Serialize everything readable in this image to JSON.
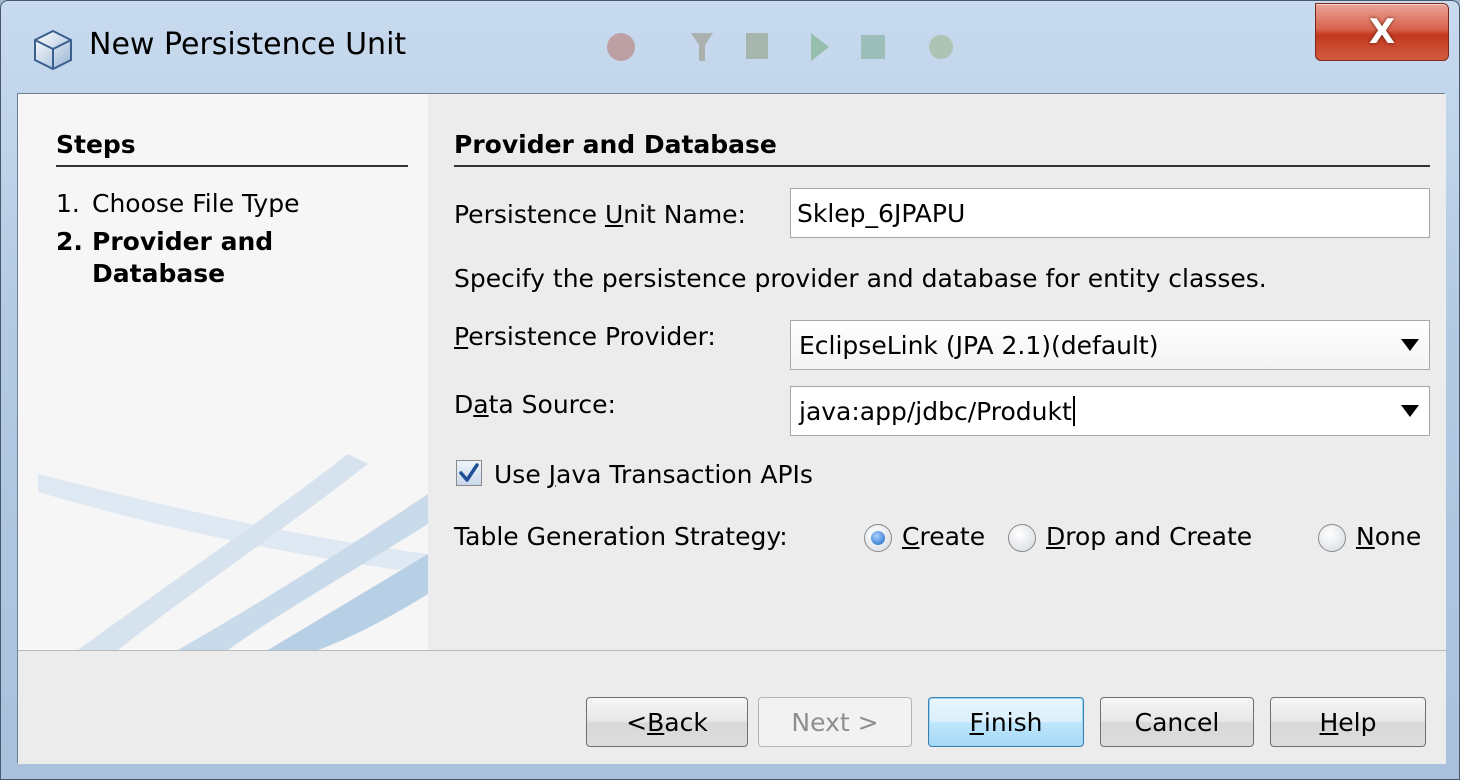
{
  "window": {
    "title": "New Persistence Unit",
    "close_label": "X"
  },
  "steps": {
    "heading": "Steps",
    "items": [
      {
        "num": "1.",
        "label": "Choose File Type"
      },
      {
        "num": "2.",
        "label": "Provider and",
        "label_line2": "Database"
      }
    ]
  },
  "form": {
    "section_title": "Provider and Database",
    "unit_name_label_pre": "Persistence ",
    "unit_name_label_u": "U",
    "unit_name_label_post": "nit Name:",
    "unit_name_value": "Sklep_6JPAPU",
    "description": "Specify the persistence provider and database for entity classes.",
    "provider_label_u": "P",
    "provider_label_post": "ersistence Provider:",
    "provider_value": "EclipseLink (JPA 2.1)(default)",
    "datasource_label_pre": "D",
    "datasource_label_u": "a",
    "datasource_label_post": "ta Source:",
    "datasource_value": "java:app/jdbc/Produkt",
    "jta_label_pre": "Use ",
    "jta_label_u": "J",
    "jta_label_post": "ava Transaction APIs",
    "jta_checked": true,
    "strategy_label": "Table Generation Strategy:",
    "strategy_options": [
      {
        "u": "C",
        "rest": "reate",
        "selected": true
      },
      {
        "u": "D",
        "rest": "rop and Create",
        "selected": false
      },
      {
        "u": "N",
        "rest": "one",
        "selected": false
      }
    ]
  },
  "buttons": {
    "back_pre": "< ",
    "back_u": "B",
    "back_post": "ack",
    "next": "Next >",
    "finish_u": "F",
    "finish_post": "inish",
    "cancel": "Cancel",
    "help_u": "H",
    "help_post": "elp"
  }
}
